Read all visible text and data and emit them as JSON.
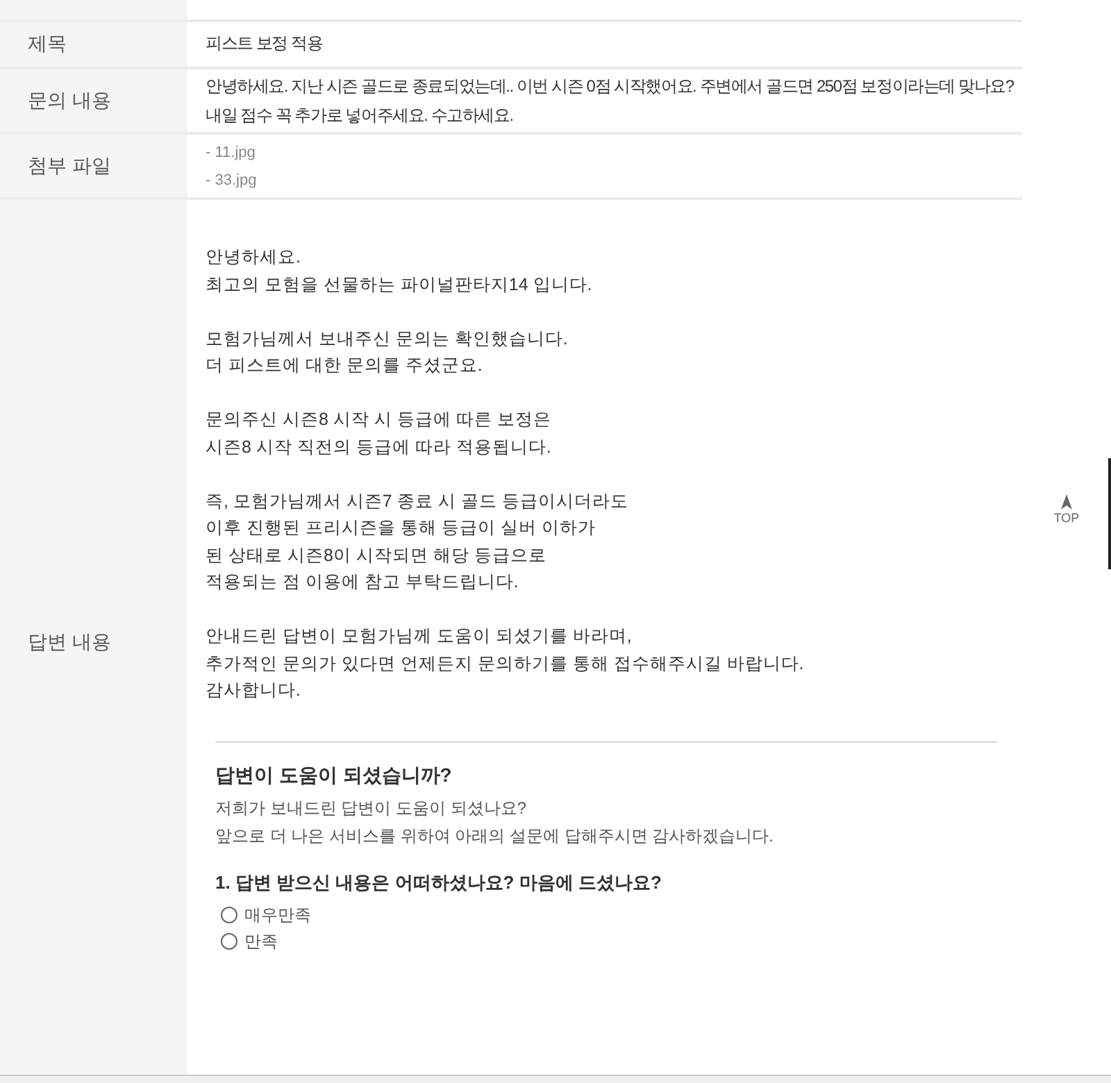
{
  "rows": [
    {
      "kind": "blank"
    },
    {
      "kind": "text",
      "label": "제목",
      "lines": [
        "피스트 보정 적용"
      ]
    },
    {
      "kind": "text",
      "label": "문의 내용",
      "lines": [
        "안녕하세요. 지난 시즌 골드로 종료되었는데.. 이번 시즌 0점 시작했어요. 주변에서 골드면 250점 보정이라는데 맞나요?",
        "내일 점수 꼭 추가로 넣어주세요. 수고하세요."
      ]
    },
    {
      "kind": "files",
      "label": "첨부 파일",
      "files": [
        "- 11.jpg",
        "- 33.jpg"
      ]
    },
    {
      "kind": "answer",
      "label": "답변 내용",
      "paragraphs": [
        [
          "안녕하세요.",
          "최고의 모험을 선물하는 파이널판타지14 입니다."
        ],
        [
          "모험가님께서 보내주신 문의는 확인했습니다.",
          "더 피스트에 대한 문의를 주셨군요."
        ],
        [
          "문의주신 시즌8 시작 시 등급에 따른 보정은",
          "시즌8 시작 직전의 등급에 따라 적용됩니다."
        ],
        [
          "즉, 모험가님께서 시즌7 종료 시 골드 등급이시더라도",
          "이후 진행된 프리시즌을 통해 등급이 실버 이하가",
          "된 상태로 시즌8이 시작되면 해당 등급으로",
          "적용되는 점 이용에 참고 부탁드립니다."
        ],
        [
          "안내드린 답변이 모험가님께 도움이 되셨기를 바라며,",
          "추가적인 문의가 있다면 언제든지 문의하기를 통해 접수해주시길 바랍니다.",
          "감사합니다."
        ]
      ],
      "survey": {
        "title": "답변이 도움이 되셨습니까?",
        "intro": [
          "저희가 보내드린 답변이 도움이 되셨나요?",
          "앞으로 더 나은 서비스를 위하여 아래의 설문에 답해주시면 감사하겠습니다."
        ],
        "question": "1. 답변 받으신 내용은 어떠하셨나요? 마음에 드셨나요?",
        "options": [
          {
            "label": "매우만족",
            "selected": false
          },
          {
            "label": "만족",
            "selected": false
          }
        ]
      }
    }
  ],
  "top_button": {
    "label": "TOP"
  }
}
